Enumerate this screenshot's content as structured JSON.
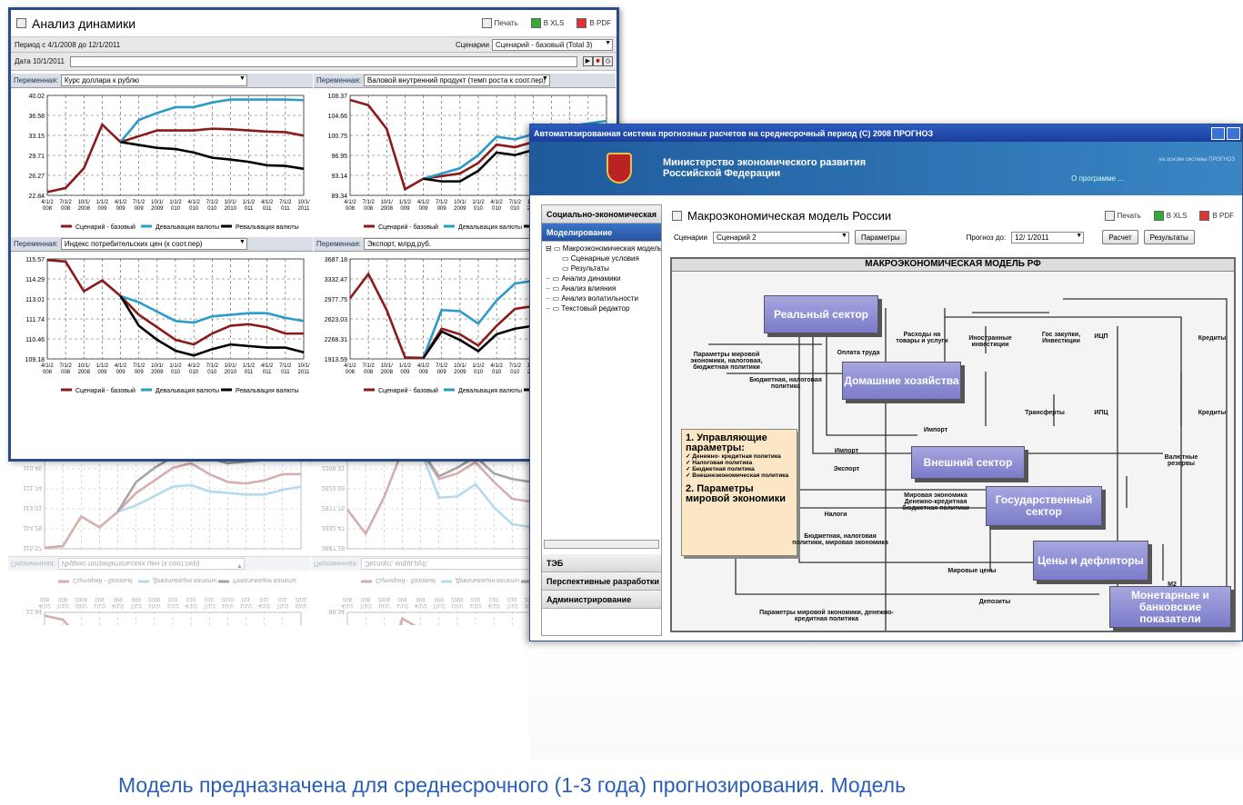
{
  "win1": {
    "title": "Анализ динамики",
    "print": "Печать",
    "xls": "В XLS",
    "pdf": "В PDF",
    "period": "Период с 4/1/2008 до 12/1/2011",
    "scen_label": "Сценарии",
    "scen_value": "Сценарий - базовый (Total 3)",
    "date_label": "Дата 10/1/2011",
    "var_label": "Переменная:",
    "panels": [
      {
        "var": "Курс доллара к рублю",
        "yticks": [
          "40.02",
          "36.58",
          "33.15",
          "29.71",
          "26.27",
          "22.84"
        ]
      },
      {
        "var": "Валовой внутренний продукт (темп роста к соот.пер)",
        "yticks": [
          "108.37",
          "104.66",
          "100.75",
          "96.95",
          "93.14",
          "89.34"
        ]
      },
      {
        "var": "Индекс потребительских цен (к соот.пер)",
        "yticks": [
          "115.57",
          "114.29",
          "113.01",
          "111.74",
          "110.46",
          "109.18"
        ]
      },
      {
        "var": "Экспорт, млрд.руб.",
        "yticks": [
          "3687.18",
          "3332.47",
          "2977.75",
          "2623.03",
          "2268.31",
          "1913.59"
        ]
      }
    ],
    "xticks": [
      "4/1/2 008",
      "7/1/2 008",
      "10/1/ 2008",
      "1/1/2 009",
      "4/1/2 009",
      "7/1/2 009",
      "10/1/ 2009",
      "1/1/2 010",
      "4/1/2 010",
      "7/1/2 010",
      "10/1/ 2010",
      "1/1/2 011",
      "4/1/2 011",
      "7/1/2 011",
      "10/1/ 2011"
    ],
    "legend": [
      "Сценарий - базовый",
      "Девальвация валюты",
      "Ревальвация валюты"
    ]
  },
  "chart_data": [
    {
      "type": "line",
      "categories": [
        "4/1/2008",
        "7/1/2008",
        "10/1/2008",
        "1/1/2009",
        "4/1/2009",
        "7/1/2009",
        "10/1/2009",
        "1/1/2010",
        "4/1/2010",
        "7/1/2010",
        "10/1/2010",
        "1/1/2011",
        "4/1/2011",
        "7/1/2011",
        "10/1/2011"
      ],
      "ylim": [
        22.84,
        40.02
      ],
      "series": [
        {
          "name": "Сценарий - базовый",
          "values": [
            23.4,
            24.1,
            27.5,
            35.0,
            32.0,
            33.0,
            34.0,
            34.0,
            34.0,
            34.3,
            34.2,
            34.0,
            33.8,
            33.7,
            33.1
          ]
        },
        {
          "name": "Девальвация валюты",
          "values": [
            null,
            null,
            null,
            null,
            32.0,
            35.8,
            37.0,
            38.0,
            38.0,
            38.8,
            39.3,
            39.3,
            39.3,
            39.3,
            39.2
          ]
        },
        {
          "name": "Ревальвация валюты",
          "values": [
            null,
            null,
            null,
            null,
            32.0,
            31.5,
            31.0,
            30.8,
            30.2,
            29.3,
            29.0,
            28.6,
            28.0,
            27.9,
            27.4
          ]
        }
      ]
    },
    {
      "type": "line",
      "categories": [
        "4/1/2008",
        "7/1/2008",
        "10/1/2008",
        "1/1/2009",
        "4/1/2009",
        "7/1/2009",
        "10/1/2009",
        "1/1/2010",
        "4/1/2010",
        "7/1/2010",
        "10/1/2010",
        "1/1/2011",
        "4/1/2011",
        "7/1/2011",
        "10/1/2011"
      ],
      "ylim": [
        89.34,
        108.37
      ],
      "series": [
        {
          "name": "Сценарий - базовый",
          "values": [
            107.5,
            106.5,
            102.0,
            90.5,
            92.5,
            93.0,
            93.5,
            95.5,
            99.0,
            98.5,
            99.5,
            100.5,
            101.0,
            101.5,
            102.0
          ]
        },
        {
          "name": "Девальвация валюты",
          "values": [
            null,
            null,
            null,
            null,
            92.5,
            93.5,
            94.5,
            97.0,
            100.5,
            100.0,
            101.0,
            102.0,
            102.5,
            103.0,
            103.5
          ]
        },
        {
          "name": "Ревальвация валюты",
          "values": [
            null,
            null,
            null,
            null,
            92.5,
            92.0,
            92.0,
            94.0,
            97.5,
            97.0,
            98.0,
            99.0,
            99.5,
            100.0,
            100.5
          ]
        }
      ]
    },
    {
      "type": "line",
      "categories": [
        "4/1/2008",
        "7/1/2008",
        "10/1/2008",
        "1/1/2009",
        "4/1/2009",
        "7/1/2009",
        "10/1/2009",
        "1/1/2010",
        "4/1/2010",
        "7/1/2010",
        "10/1/2010",
        "1/1/2011",
        "4/1/2011",
        "7/1/2011",
        "10/1/2011"
      ],
      "ylim": [
        109.18,
        115.57
      ],
      "series": [
        {
          "name": "Сценарий - базовый",
          "values": [
            115.5,
            115.4,
            113.5,
            114.2,
            113.2,
            112.0,
            111.2,
            110.4,
            110.1,
            110.8,
            111.3,
            111.4,
            111.2,
            110.8,
            110.8
          ]
        },
        {
          "name": "Девальвация валюты",
          "values": [
            null,
            null,
            null,
            null,
            113.2,
            112.8,
            112.2,
            111.6,
            111.5,
            111.9,
            112.0,
            112.1,
            112.1,
            111.8,
            111.6
          ]
        },
        {
          "name": "Ревальвация валюты",
          "values": [
            null,
            null,
            null,
            null,
            113.2,
            111.3,
            110.4,
            109.7,
            109.4,
            109.8,
            110.1,
            110.0,
            109.9,
            109.9,
            109.6
          ]
        }
      ]
    },
    {
      "type": "line",
      "categories": [
        "4/1/2008",
        "7/1/2008",
        "10/1/2008",
        "1/1/2009",
        "4/1/2009",
        "7/1/2009",
        "10/1/2009",
        "1/1/2010",
        "4/1/2010",
        "7/1/2010",
        "10/1/2010",
        "1/1/2011",
        "4/1/2011",
        "7/1/2011",
        "10/1/2011"
      ],
      "ylim": [
        1913.59,
        3687.18
      ],
      "series": [
        {
          "name": "Сценарий - базовый",
          "values": [
            2990,
            3420,
            2780,
            1940,
            1930,
            2450,
            2350,
            2150,
            2500,
            2800,
            2850,
            2900,
            2950,
            3000,
            3050
          ]
        },
        {
          "name": "Девальвация валюты",
          "values": [
            null,
            null,
            null,
            null,
            1930,
            2780,
            2760,
            2540,
            2950,
            3250,
            3300,
            3350,
            3400,
            3450,
            3500
          ]
        },
        {
          "name": "Ревальвация валюты",
          "values": [
            null,
            null,
            null,
            null,
            1930,
            2400,
            2250,
            2050,
            2350,
            2450,
            2500,
            2550,
            2600,
            2650,
            2700
          ]
        }
      ]
    }
  ],
  "win2": {
    "title": "Автоматизированная система прогнозных расчетов на среднесрочный период (С) 2008 ПРОГНОЗ",
    "ministry": "Министерство экономического развития Российской Федерации",
    "about": "О программе ...",
    "system_note": "на основе системы ПРОГНОЗ",
    "side": [
      "Социально-экономическая",
      "Моделирование",
      "ТЭБ",
      "Перспективные разработки",
      "Администрирование"
    ],
    "tree": [
      "Макроэкономическая модель",
      "Сценарные условия",
      "Результаты",
      "Анализ динамики",
      "Анализ влияния",
      "Анализ волатильности",
      "Текстовый редактор"
    ],
    "main_title": "Макроэкономическая модель России",
    "scen_label": "Сценарии",
    "scen_value": "Сценарий 2",
    "params_btn": "Параметры",
    "forecast_label": "Прогноз до:",
    "forecast_value": "12/ 1/2011",
    "calc_btn": "Расчет",
    "results_btn": "Результаты",
    "diagram_title": "МАКРОЭКОНОМИЧЕСКАЯ МОДЕЛЬ РФ",
    "boxes": {
      "real": "Реальный сектор",
      "house": "Домашние хозяйства",
      "ext": "Внешний сектор",
      "gov": "Государственный сектор",
      "prices": "Цены и дефляторы",
      "money": "Монетарные и банковские показатели"
    },
    "ctrl_title": "1. Управляющие параметры:",
    "ctrl_items": [
      "✓ Денежно- кредитная политика",
      "✓ Налоговая политика",
      "✓ Бюджетная политика",
      "✓ Внешнеэкономическая политика"
    ],
    "ctrl_title2": "2. Параметры мировой экономики",
    "labels": [
      "Параметры мировой экономики, налоговая, бюджетная политики",
      "Расходы на товары и услуги",
      "Иностранные инвестиции",
      "Гос закупки, Инвестиции",
      "ИЦП",
      "Кредиты",
      "Оплата труда",
      "Бюджетная, налоговая политика",
      "Трансферты",
      "ИПЦ",
      "Кредиты",
      "Импорт",
      "Импорт",
      "Экспорт",
      "Валютные резервы",
      "Мировая экономика Денежно-кредитная бюджетная политики",
      "Налоги",
      "Бюджетная, налоговая политики, мировая экономика",
      "Мировые цены",
      "M2",
      "Депозиты",
      "Параметры мировой экономики, денежно-кредитная политика"
    ]
  },
  "caption": "Модель предназначена для среднесрочного (1-3 года) прогнозирования. Модель"
}
